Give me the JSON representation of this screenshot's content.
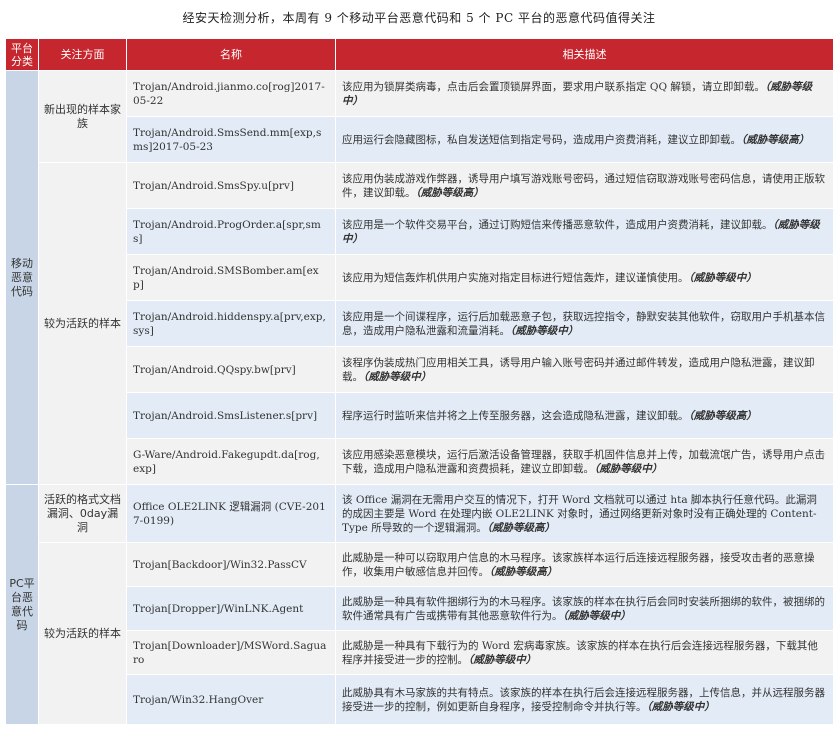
{
  "caption": "经安天检测分析，本周有 9 个移动平台恶意代码和 5 个 PC 平台的恶意代码值得关注",
  "headers": {
    "category": "平台分类",
    "focus": "关注方面",
    "name": "名称",
    "desc": "相关描述"
  },
  "mobile": {
    "category": "移动恶意代码",
    "focus_new": "新出现的样本家族",
    "focus_active": "较为活跃的样本",
    "rows": [
      {
        "name": "Trojan/Android.jianmo.co[rog]2017-05-22",
        "desc": "该应用为锁屏类病毒，点击后会置顶锁屏界面，要求用户联系指定 QQ 解锁，请立即卸载。",
        "level": "（威胁等级中）"
      },
      {
        "name": "Trojan/Android.SmsSend.mm[exp,sms]2017-05-23",
        "desc": "应用运行会隐藏图标，私自发送短信到指定号码，造成用户资费消耗，建议立即卸载。",
        "level": "（威胁等级高）"
      },
      {
        "name": "Trojan/Android.SmsSpy.u[prv]",
        "desc": "该应用伪装成游戏作弊器，诱导用户填写游戏账号密码，通过短信窃取游戏账号密码信息，请使用正版软件，建议卸载。",
        "level": "（威胁等级高）"
      },
      {
        "name": "Trojan/Android.ProgOrder.a[spr,sms]",
        "desc": "该应用是一个软件交易平台，通过订购短信来传播恶意软件，造成用户资费消耗，建议卸载。",
        "level": "（威胁等级中）"
      },
      {
        "name": "Trojan/Android.SMSBomber.am[exp]",
        "desc": "该应用为短信轰炸机供用户实施对指定目标进行短信轰炸，建议谨慎使用。",
        "level": "（威胁等级中）"
      },
      {
        "name": "Trojan/Android.hiddenspy.a[prv,exp, sys]",
        "desc": "该应用是一个间谍程序，运行后加载恶意子包，获取远控指令，静默安装其他软件，窃取用户手机基本信息，造成用户隐私泄露和流量消耗。",
        "level": "（威胁等级中）"
      },
      {
        "name": "Trojan/Android.QQspy.bw[prv]",
        "desc": "该程序伪装成热门应用相关工具，诱导用户输入账号密码并通过邮件转发，造成用户隐私泄露，建议卸载。",
        "level": "（威胁等级中）"
      },
      {
        "name": "Trojan/Android.SmsListener.s[prv]",
        "desc": "程序运行时监听来信并将之上传至服务器，这会造成隐私泄露，建议卸载。",
        "level": "（威胁等级高）"
      },
      {
        "name": "G-Ware/Android.Fakegupdt.da[rog, exp]",
        "desc": "该应用感染恶意模块，运行后激活设备管理器，获取手机固件信息并上传，加载流氓广告，诱导用户点击下载，造成用户隐私泄露和资费损耗，建议立即卸载。",
        "level": "（威胁等级中）"
      }
    ]
  },
  "pc": {
    "category": "PC平台恶意代码",
    "focus_vuln": "活跃的格式文档漏洞、0day漏洞",
    "focus_active": "较为活跃的样本",
    "rows": [
      {
        "name": "Office OLE2LINK 逻辑漏洞 (CVE-2017-0199)",
        "desc": "该 Office 漏洞在无需用户交互的情况下，打开 Word 文档就可以通过 hta 脚本执行任意代码。此漏洞的成因主要是 Word 在处理内嵌 OLE2LINK 对象时，通过网络更新对象时没有正确处理的 Content-Type 所导致的一个逻辑漏洞。",
        "level": "（威胁等级高）"
      },
      {
        "name": "Trojan[Backdoor]/Win32.PassCV",
        "desc": "此威胁是一种可以窃取用户信息的木马程序。该家族样本运行后连接远程服务器，接受攻击者的恶意操作，收集用户敏感信息并回传。",
        "level": "（威胁等级高）"
      },
      {
        "name": "Trojan[Dropper]/WinLNK.Agent",
        "desc": "此威胁是一种具有软件捆绑行为的木马程序。该家族的样本在执行后会同时安装所捆绑的软件，被捆绑的软件通常具有广告或携带有其他恶意软件行为。",
        "level": "（威胁等级中）"
      },
      {
        "name": "Trojan[Downloader]/MSWord.Saguaro",
        "desc": "此威胁是一种具有下载行为的 Word 宏病毒家族。该家族的样本在执行后会连接远程服务器，下载其他程序并接受进一步的控制。",
        "level": "（威胁等级中）"
      },
      {
        "name": "Trojan/Win32.HangOver",
        "desc": "此威胁具有木马家族的共有特点。该家族的样本在执行后会连接远程服务器，上传信息，并从远程服务器接受进一步的控制，例如更新自身程序，接受控制命令并执行等。",
        "level": "（威胁等级中）"
      }
    ]
  }
}
